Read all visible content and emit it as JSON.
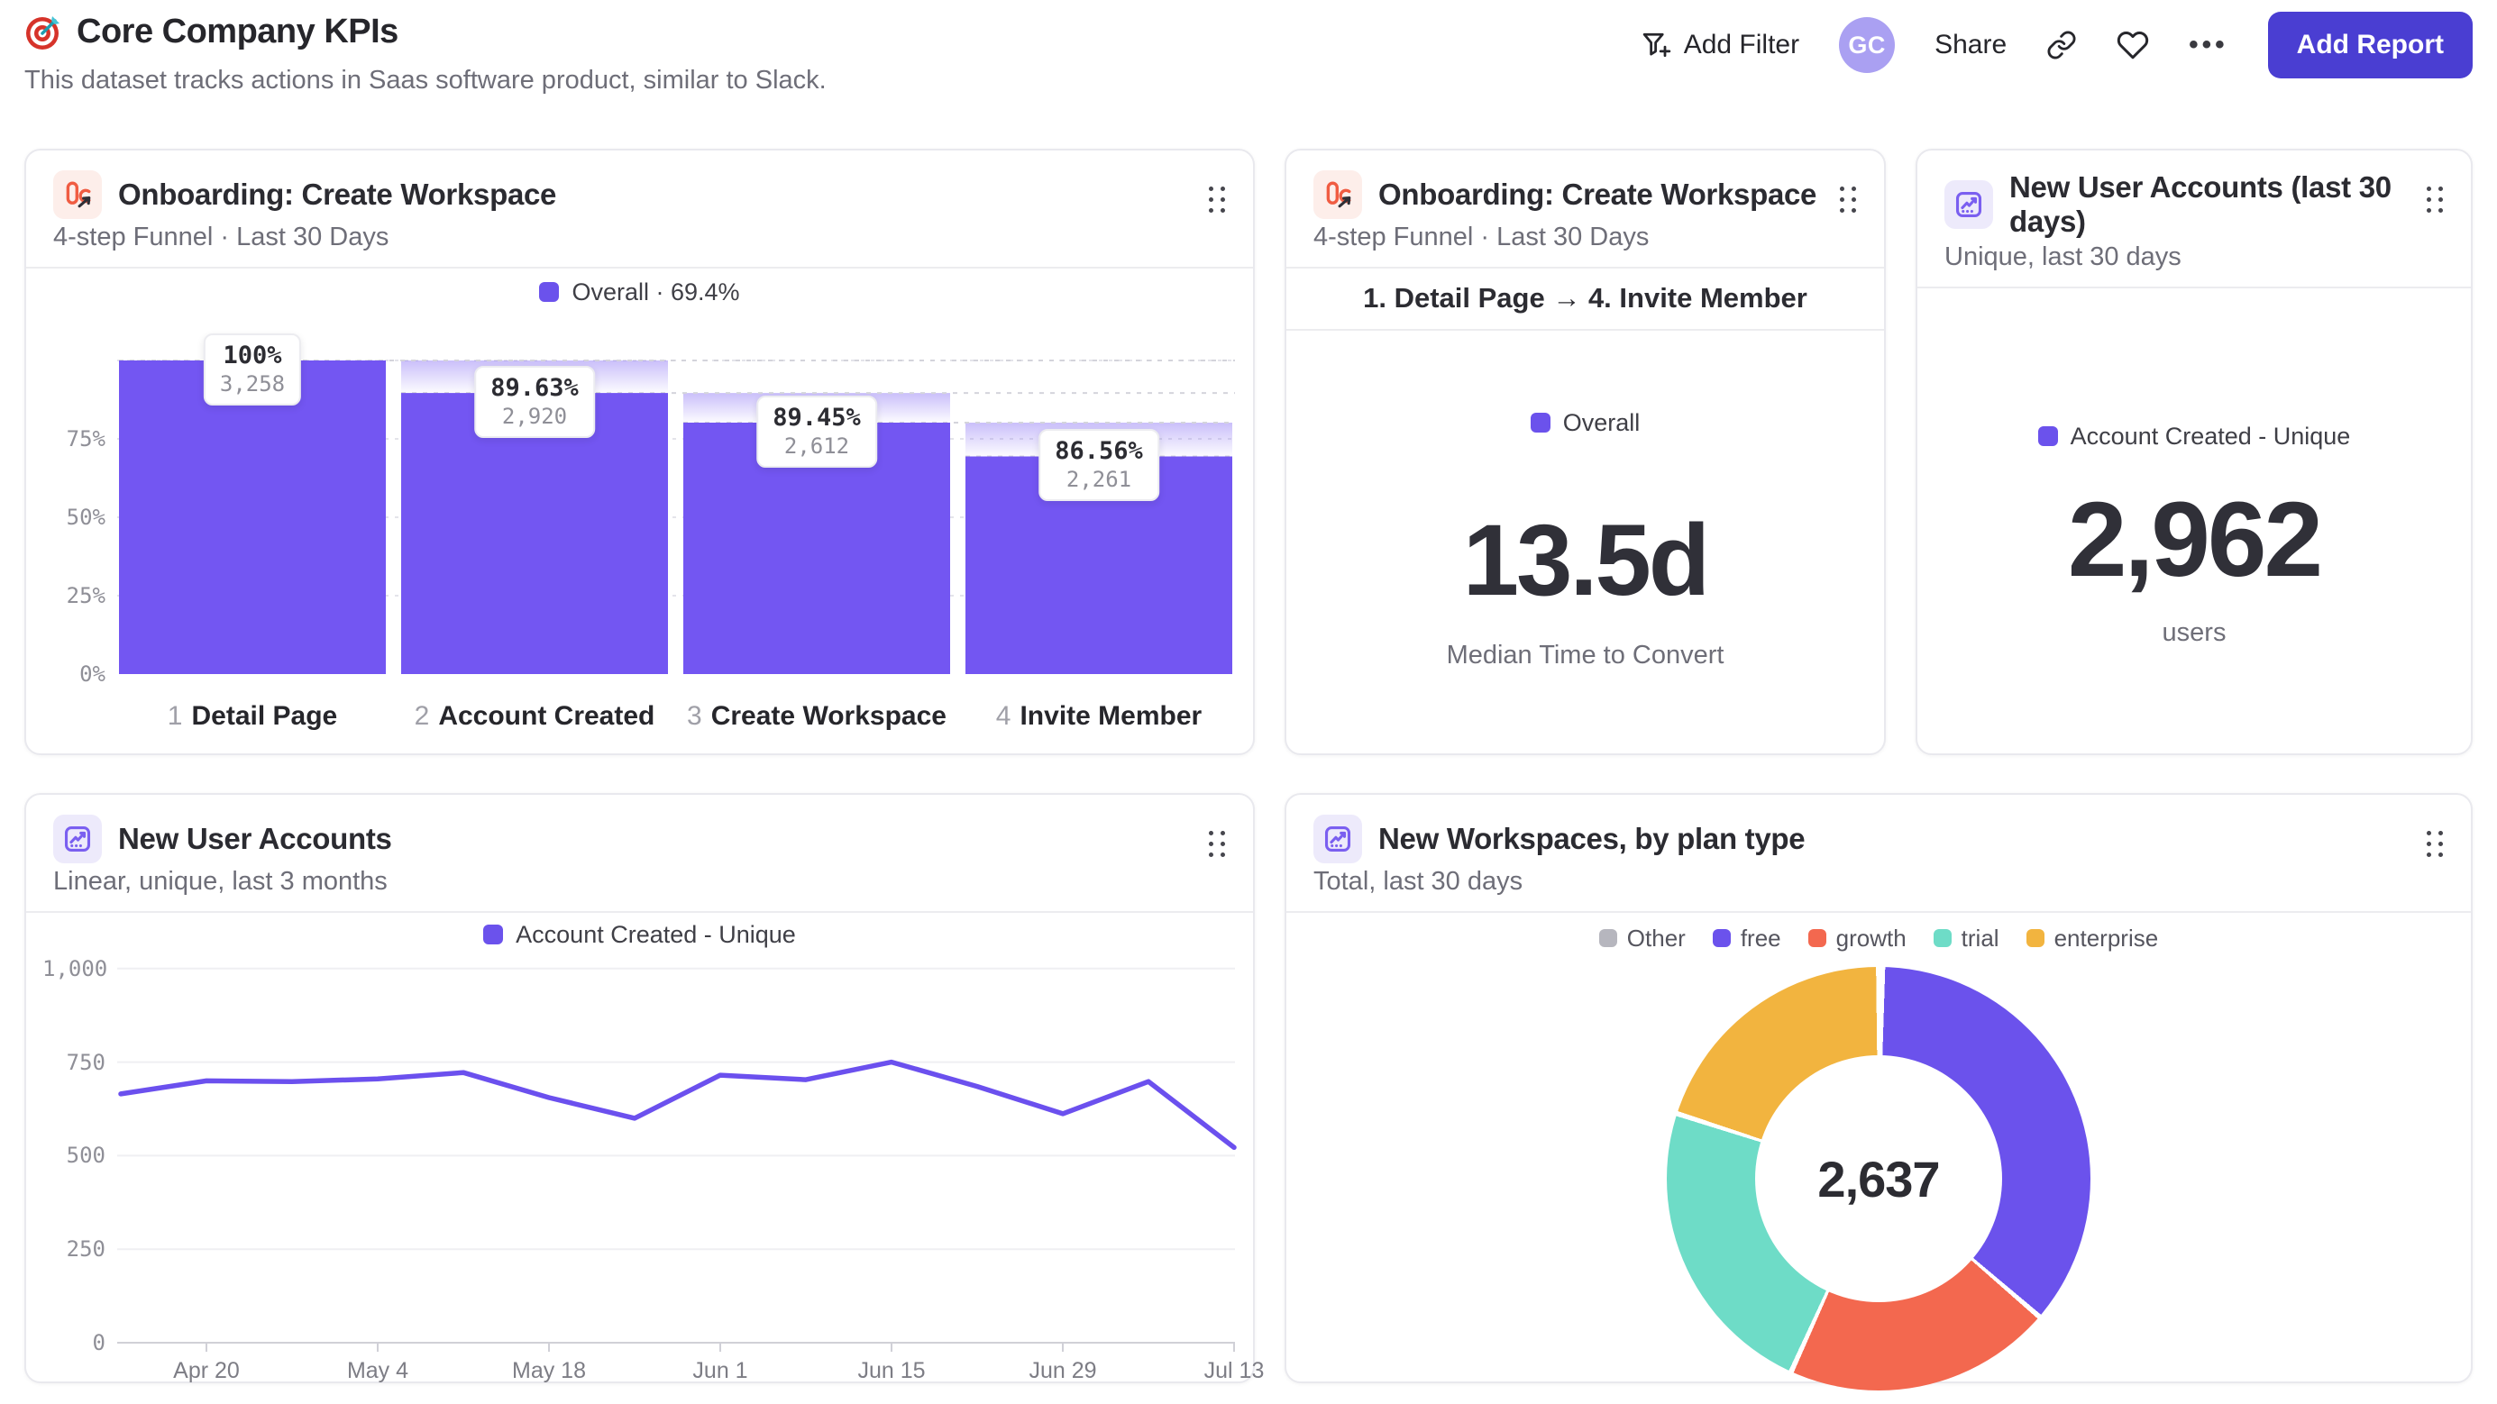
{
  "header": {
    "title": "Core Company KPIs",
    "subtitle": "This dataset tracks actions in Saas software product, similar to Slack.",
    "add_filter_label": "Add Filter",
    "avatar_initials": "GC",
    "share_label": "Share",
    "more_label": "•••",
    "add_report_label": "Add Report"
  },
  "colors": {
    "accent": "#6b52ec",
    "button": "#4a3ed2",
    "avatar": "#aaa0f2",
    "funnel_icon": "#f05c42",
    "chart_icon": "#7a5ff0"
  },
  "cards": {
    "funnel": {
      "title": "Onboarding: Create Workspace",
      "subtitle": "4-step Funnel · Last 30 Days",
      "legend_label": "Overall · 69.4%"
    },
    "time_to_convert": {
      "title": "Onboarding: Create Workspace",
      "subtitle": "4-step Funnel · Last 30 Days",
      "range_label": "1. Detail Page → 4. Invite Member",
      "legend_label": "Overall",
      "value": "13.5d",
      "caption": "Median Time to Convert"
    },
    "new_accounts": {
      "title": "New User Accounts (last 30 days)",
      "subtitle": "Unique, last 30 days",
      "legend_label": "Account Created - Unique",
      "value": "2,962",
      "caption": "users"
    },
    "accounts_trend": {
      "title": "New User Accounts",
      "subtitle": "Linear, unique, last 3 months",
      "legend_label": "Account Created - Unique"
    },
    "workspaces_by_plan": {
      "title": "New Workspaces, by plan type",
      "subtitle": "Total, last 30 days",
      "center_value": "2,637"
    }
  },
  "chart_data": [
    {
      "id": "onboarding_funnel",
      "type": "bar",
      "title": "Onboarding: Create Workspace",
      "overall_conversion": "69.4%",
      "step_numbers": [
        "1",
        "2",
        "3",
        "4"
      ],
      "categories": [
        "Detail Page",
        "Account Created",
        "Create Workspace",
        "Invite Member"
      ],
      "values": [
        3258,
        2920,
        2612,
        2261
      ],
      "value_labels": [
        "3,258",
        "2,920",
        "2,612",
        "2,261"
      ],
      "percent_labels": [
        "100%",
        "89.63%",
        "89.45%",
        "86.56%"
      ],
      "yticks": [
        "75%",
        "50%",
        "25%",
        "0%"
      ],
      "ylim": [
        0,
        100
      ],
      "grid": true,
      "legend_position": "top",
      "bar_color": "#7356f2"
    },
    {
      "id": "new_user_accounts_linear",
      "type": "line",
      "x": [
        "Apr 13",
        "Apr 20",
        "Apr 27",
        "May 4",
        "May 11",
        "May 18",
        "May 25",
        "Jun 1",
        "Jun 8",
        "Jun 15",
        "Jun 22",
        "Jun 29",
        "Jul 6",
        "Jul 13"
      ],
      "series": [
        {
          "name": "Account Created - Unique",
          "values": [
            665,
            700,
            698,
            705,
            722,
            655,
            600,
            715,
            703,
            750,
            685,
            612,
            698,
            522
          ]
        }
      ],
      "x_tick_labels": [
        "Apr 20",
        "May 4",
        "May 18",
        "Jun 1",
        "Jun 15",
        "Jun 29",
        "Jul 13"
      ],
      "yticks": [
        1000,
        750,
        500,
        250,
        0
      ],
      "ytick_labels": [
        "1,000",
        "750",
        "500",
        "250",
        "0"
      ],
      "ylim": [
        0,
        1030
      ],
      "grid": true,
      "legend_position": "top",
      "line_color": "#6b50ee"
    },
    {
      "id": "new_workspaces_by_plan_type",
      "type": "pie",
      "donut": true,
      "labels": [
        "Other",
        "free",
        "growth",
        "trial",
        "enterprise"
      ],
      "values": [
        8,
        949,
        540,
        612,
        528
      ],
      "colors": [
        "#b6b6be",
        "#6b52ec",
        "#f3684f",
        "#6edcc7",
        "#f2b43f"
      ],
      "total_label": "2,637",
      "legend_position": "top"
    }
  ]
}
